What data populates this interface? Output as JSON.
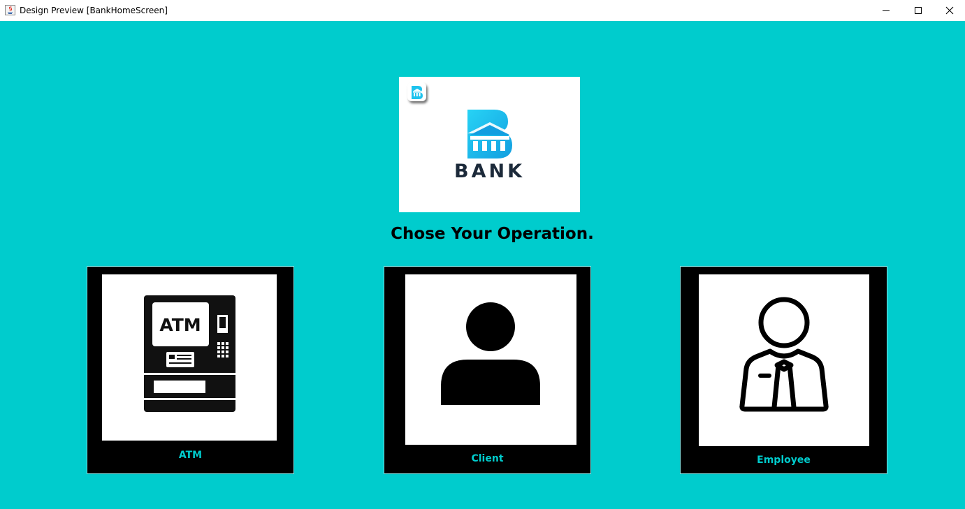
{
  "window": {
    "title": "Design Preview [BankHomeScreen]",
    "controls": [
      "minimize",
      "maximize",
      "close"
    ]
  },
  "logo": {
    "brand_text": "BANK",
    "icon": "bank-building-icon",
    "colors": {
      "primary": "#1ec3ee",
      "text": "#1c2a3a"
    }
  },
  "heading": "Chose Your Operation.",
  "operations": [
    {
      "label": "ATM",
      "icon": "atm-machine-icon",
      "screen_text": "ATM"
    },
    {
      "label": "Client",
      "icon": "user-silhouette-icon"
    },
    {
      "label": "Employee",
      "icon": "employee-tie-icon"
    }
  ],
  "colors": {
    "background": "#00cccd",
    "tile": "#000000",
    "tile_label": "#00cccd"
  }
}
